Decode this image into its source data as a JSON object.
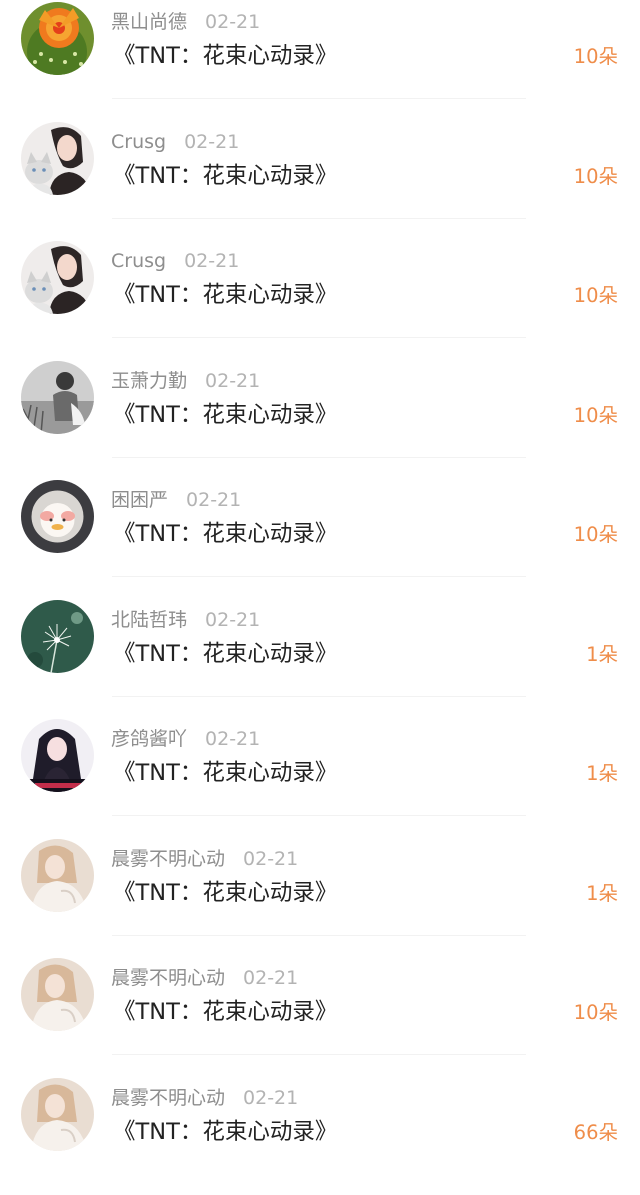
{
  "gift_list": {
    "items": [
      {
        "name": "黑山尚德",
        "date": "02-21",
        "work": "《TNT：花束心动录》",
        "gift": "10朵",
        "avatar": "cactus-flower"
      },
      {
        "name": "Crusg",
        "date": "02-21",
        "work": "《TNT：花束心动录》",
        "gift": "10朵",
        "avatar": "girl-with-cat"
      },
      {
        "name": "Crusg",
        "date": "02-21",
        "work": "《TNT：花束心动录》",
        "gift": "10朵",
        "avatar": "girl-with-cat"
      },
      {
        "name": "玉萧力勤",
        "date": "02-21",
        "work": "《TNT：花束心动录》",
        "gift": "10朵",
        "avatar": "grayscale-portrait"
      },
      {
        "name": "困困严",
        "date": "02-21",
        "work": "《TNT：花束心动录》",
        "gift": "10朵",
        "avatar": "plush-toy"
      },
      {
        "name": "北陆哲玮",
        "date": "02-21",
        "work": "《TNT：花束心动录》",
        "gift": "1朵",
        "avatar": "dandelion"
      },
      {
        "name": "彦鸽酱吖",
        "date": "02-21",
        "work": "《TNT：花束心动录》",
        "gift": "1朵",
        "avatar": "anime-girl"
      },
      {
        "name": "晨雾不明心动",
        "date": "02-21",
        "work": "《TNT：花束心动录》",
        "gift": "1朵",
        "avatar": "girl-white-sweater"
      },
      {
        "name": "晨雾不明心动",
        "date": "02-21",
        "work": "《TNT：花束心动录》",
        "gift": "10朵",
        "avatar": "girl-white-sweater"
      },
      {
        "name": "晨雾不明心动",
        "date": "02-21",
        "work": "《TNT：花束心动录》",
        "gift": "66朵",
        "avatar": "girl-white-sweater"
      }
    ]
  },
  "colors": {
    "name": "#8e8e8e",
    "date": "#b3b3b3",
    "work": "#222222",
    "gift": "#ef8d4a"
  }
}
